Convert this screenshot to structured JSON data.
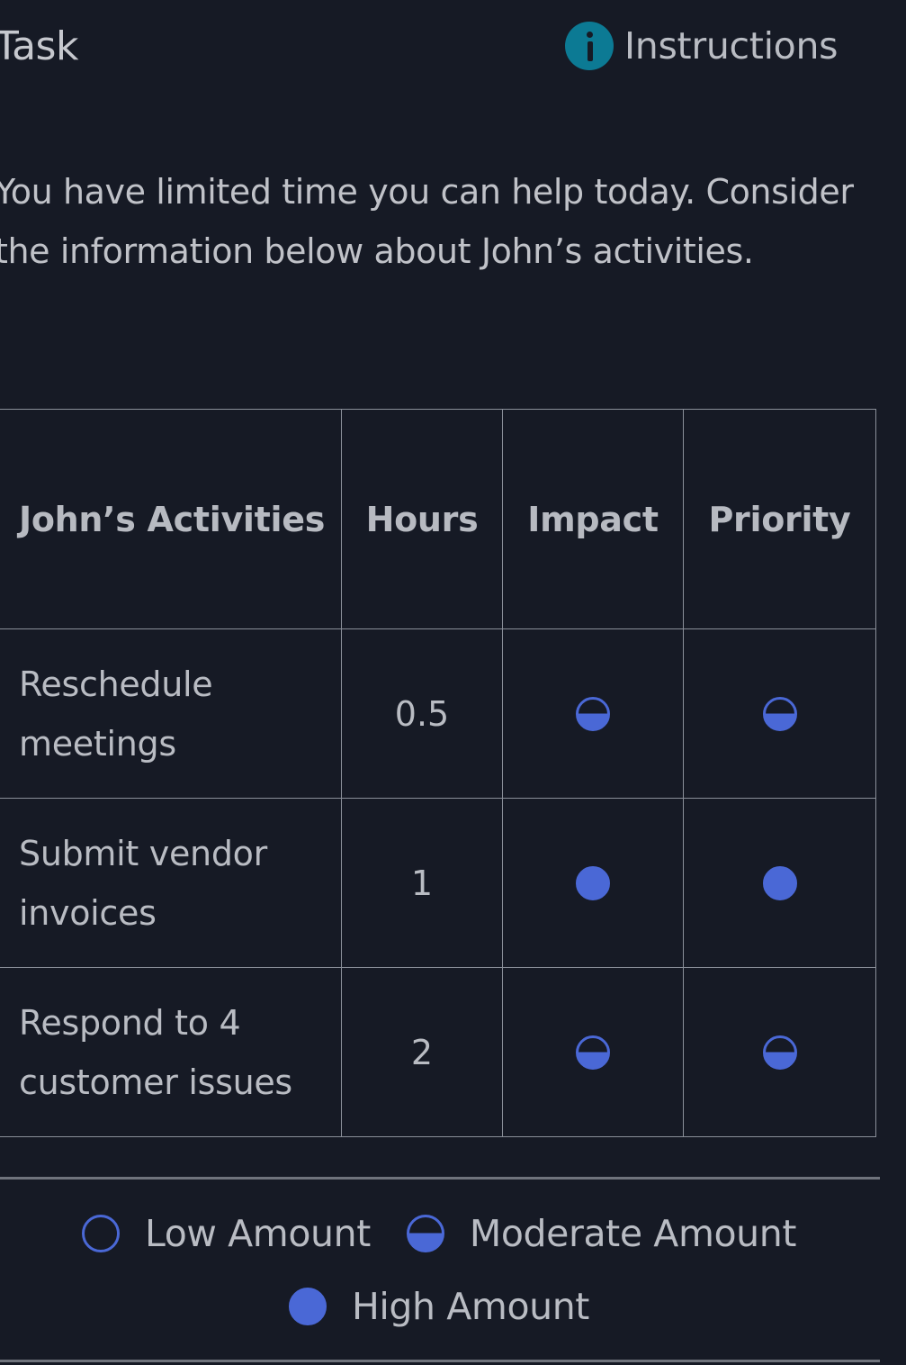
{
  "header": {
    "title": "Task",
    "instructions_label": "Instructions",
    "instructions_icon": "info-icon"
  },
  "intro": {
    "text": "You have limited time you can help today. Consider the information below about John’s activities."
  },
  "table": {
    "headers": {
      "activity": "John’s Activities",
      "hours": "Hours",
      "impact": "Impact",
      "priority": "Priority"
    },
    "rows": [
      {
        "activity": "Reschedule meetings",
        "hours": "0.5",
        "impact": "moderate",
        "priority": "moderate"
      },
      {
        "activity": "Submit vendor invoices",
        "hours": "1",
        "impact": "high",
        "priority": "high"
      },
      {
        "activity": "Respond to 4 customer issues",
        "hours": "2",
        "impact": "moderate",
        "priority": "moderate"
      }
    ]
  },
  "legend": {
    "low": "Low Amount",
    "moderate": "Moderate Amount",
    "high": "High Amount"
  },
  "colors": {
    "background": "#161a25",
    "rating_blue": "#4a68d6",
    "info_teal": "#0c7a94",
    "text": "#b9bcc3"
  }
}
